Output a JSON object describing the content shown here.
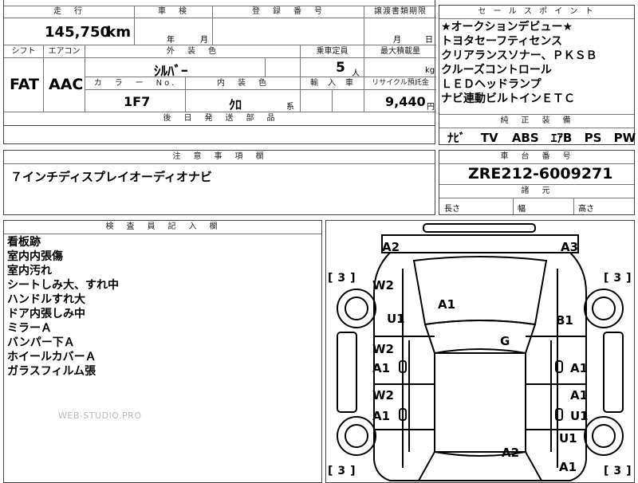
{
  "top": {
    "mileage_header": "走　行",
    "mileage_value": "145,750",
    "mileage_unit": "km",
    "inspection_header": "車　検",
    "inspection_year_unit": "年",
    "inspection_month_unit": "月",
    "registration_header": "登　録　番　号",
    "transfer_header": "譲渡書類期限",
    "transfer_month_unit": "月",
    "transfer_day_unit": "日",
    "shift_header": "シフト",
    "shift_value": "FAT",
    "aircon_header": "エアコン",
    "aircon_value": "AAC",
    "exterior_color_header": "外　装　色",
    "exterior_color_value": "ｼﾙﾊﾞｰ",
    "capacity_header": "乗車定員",
    "capacity_value": "5",
    "capacity_unit": "人",
    "max_load_header": "最大積載量",
    "max_load_unit": "kg",
    "color_no_header": "カ　ラ　ー　No.",
    "color_no_value": "1F7",
    "interior_color_header": "内　装　色",
    "interior_color_value": "ｸﾛ",
    "interior_suffix": "系",
    "import_header": "輸　入　車",
    "recycle_header": "リサイクル預託金",
    "recycle_value": "9,440",
    "recycle_unit": "円",
    "later_parts_header": "後　日　発　送　部　品"
  },
  "sales_points": {
    "header": "セ ー ル ス ポ イ ン ト",
    "items": [
      "★オークションデビュー★",
      "トヨタセーフティセンス",
      "クリアランスソナー、ＰＫＳＢ",
      "クルーズコントロール",
      "ＬＥＤヘッドランプ",
      "ナビ連動ビルトインＥＴＣ"
    ],
    "genuine_header": "純　正　装　備",
    "genuine_items": [
      "ﾅﾋﾞ",
      "TV",
      "ABS",
      "ｴｱB",
      "PS",
      "PW"
    ]
  },
  "notes": {
    "header": "注　意　事　項　欄",
    "text": "７インチディスプレイオーディオナビ"
  },
  "chassis": {
    "header": "車　台　番　号",
    "value": "ZRE212-6009271",
    "dims_header": "諸　元",
    "length_label": "長さ",
    "width_label": "幅",
    "height_label": "高さ"
  },
  "inspector": {
    "header": "検　査　員　記　入　欄",
    "lines": [
      "看板跡",
      "室内内張傷",
      "室内汚れ",
      "シートしみ大、すれ中",
      "ハンドルすれ大",
      "ドア内張しみ中",
      "ミラーＡ",
      "バンパー下Ａ",
      "ホイールカバーＡ",
      "ガラスフィルム張"
    ],
    "watermark": "WEB-STUDIO.PRO"
  },
  "diagram": {
    "tire_left_top": "3",
    "tire_right_top": "3",
    "tire_left_bottom": "3",
    "tire_right_bottom": "3",
    "marks": {
      "front_left_corner": "A2",
      "front_right_corner": "A3",
      "left_fender": "W2",
      "left_fender_2": "U1",
      "hood": "A1",
      "right_fender": "B1",
      "roof": "G",
      "left_front_door_1": "W2",
      "left_front_door_2": "A1",
      "right_front_door": "A1",
      "left_rear_door_1": "W2",
      "left_rear_door_2": "A1",
      "right_rear_door_1": "A1",
      "right_rear_door_2": "U1",
      "right_rear_quarter": "U1",
      "trunk": "A2",
      "rear_right": "A1"
    }
  }
}
